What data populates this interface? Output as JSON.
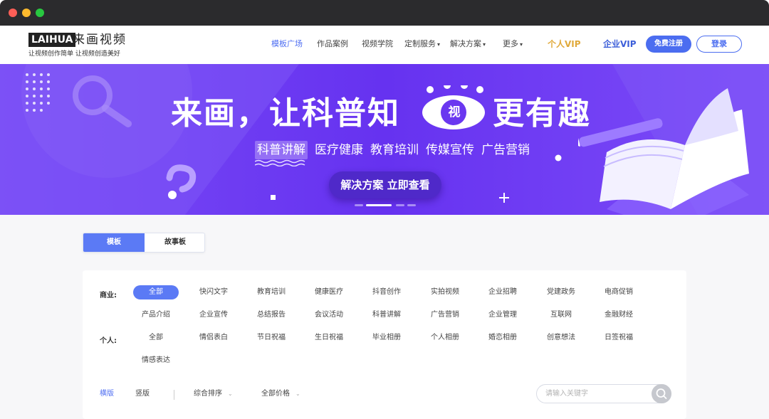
{
  "logo": {
    "brand_latin": "LAIHUA",
    "brand_cn": "来画视频",
    "slogan": "让视频创作简单  让视频创造美好"
  },
  "nav": {
    "items": [
      {
        "label": "模板广场",
        "active": true
      },
      {
        "label": "作品案例"
      },
      {
        "label": "视频学院"
      },
      {
        "label": "定制服务",
        "dropdown": true
      },
      {
        "label": "解决方案",
        "dropdown": true
      },
      {
        "label": "更多",
        "dropdown": true
      }
    ],
    "vip_personal": "个人VIP",
    "vip_business": "企业VIP",
    "register": "免费注册",
    "login": "登录",
    "caret": "▾"
  },
  "banner": {
    "title": "来画，让科普知",
    "eye_char": "视",
    "title_tail": "更有趣",
    "topics": [
      "科普讲解",
      "医疗健康",
      "教育培训",
      "传媒宣传",
      "广告营销"
    ],
    "cta": "解决方案 立即查看",
    "slide_active": 2,
    "slide_count": 4,
    "colors": {
      "primary": "#6a37f0",
      "accent": "#7b46ff"
    }
  },
  "tabs": {
    "template": "模板",
    "storyboard": "故事板",
    "selected": "模板"
  },
  "categories": {
    "business_label": "商业:",
    "business": [
      "全部",
      "快闪文字",
      "教育培训",
      "健康医疗",
      "抖音创作",
      "实拍视频",
      "企业招聘",
      "党建政务",
      "电商促销",
      "产品介绍",
      "企业宣传",
      "总结报告",
      "会议活动",
      "科普讲解",
      "广告营销",
      "企业管理",
      "互联网",
      "金融财经"
    ],
    "personal_label": "个人:",
    "personal": [
      "全部",
      "情侣表白",
      "节日祝福",
      "生日祝福",
      "毕业相册",
      "个人相册",
      "婚恋相册",
      "创意想法",
      "日签祝福",
      "情感表达"
    ],
    "selected": "全部"
  },
  "filters": {
    "orientation_h": "横版",
    "orientation_v": "竖版",
    "sort": "综合排序",
    "price": "全部价格",
    "chevron": "⌄",
    "search_placeholder": "请输入关键字"
  }
}
